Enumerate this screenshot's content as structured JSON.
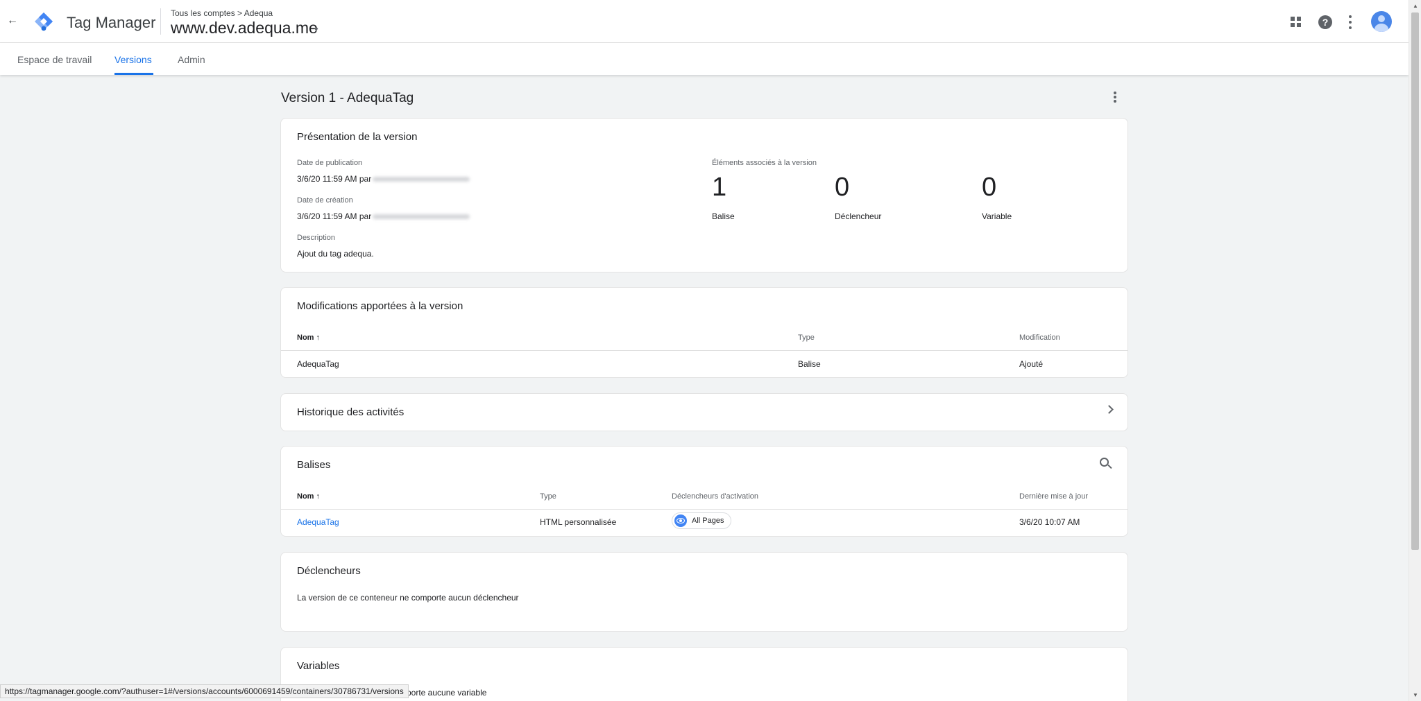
{
  "header": {
    "back_symbol": "←",
    "app_title": "Tag Manager",
    "breadcrumb": "Tous les comptes > Adequa",
    "container_name": "www.dev.adequa.me",
    "caret": "▾",
    "help_symbol": "?"
  },
  "tabs": [
    {
      "label": "Espace de travail"
    },
    {
      "label": "Versions",
      "active": true
    },
    {
      "label": "Admin"
    }
  ],
  "version_title": "Version 1 - AdequaTag",
  "overview": {
    "title": "Présentation de la version",
    "pub_date_label": "Date de publication",
    "pub_date_value": "3/6/20 11:59 AM par",
    "created_label": "Date de création",
    "created_value": "3/6/20 11:59 AM par",
    "description_label": "Description",
    "description_value": "Ajout du tag adequa.",
    "elements_label": "Éléments associés à la version",
    "stats": [
      {
        "count": "1",
        "label": "Balise"
      },
      {
        "count": "0",
        "label": "Déclencheur"
      },
      {
        "count": "0",
        "label": "Variable"
      }
    ]
  },
  "changes": {
    "title": "Modifications apportées à la version",
    "columns": {
      "name": "Nom",
      "type": "Type",
      "modification": "Modification"
    },
    "sort_arrow": "↑",
    "rows": [
      {
        "name": "AdequaTag",
        "type": "Balise",
        "modification": "Ajouté"
      }
    ]
  },
  "history": {
    "title": "Historique des activités"
  },
  "tags": {
    "title": "Balises",
    "columns": {
      "name": "Nom",
      "type": "Type",
      "triggers": "Déclencheurs d'activation",
      "updated": "Dernière mise à jour"
    },
    "sort_arrow": "↑",
    "rows": [
      {
        "name": "AdequaTag",
        "type": "HTML personnalisée",
        "trigger": "All Pages",
        "updated": "3/6/20 10:07 AM"
      }
    ]
  },
  "triggers": {
    "title": "Déclencheurs",
    "empty_text": "La version de ce conteneur ne comporte aucun déclencheur"
  },
  "variables": {
    "title": "Variables",
    "empty_text_partial": "porte aucune variable"
  },
  "status_url": "https://tagmanager.google.com/?authuser=1#/versions/accounts/6000691459/containers/30786731/versions",
  "scrollbar": {
    "up": "▲",
    "down": "▼"
  },
  "colors": {
    "accent": "#1a73e8",
    "page_bg": "#f1f3f4",
    "card_bg": "#ffffff",
    "chip_icon": "#4285f4"
  },
  "icons": {
    "back": "back-arrow-icon",
    "logo": "tag-manager-logo-icon",
    "apps": "apps-grid-icon",
    "help": "help-icon",
    "more": "more-vert-icon",
    "account": "account-avatar-icon",
    "history": "chevron-right-icon",
    "search": "search-icon",
    "trigger": "eye-icon"
  }
}
